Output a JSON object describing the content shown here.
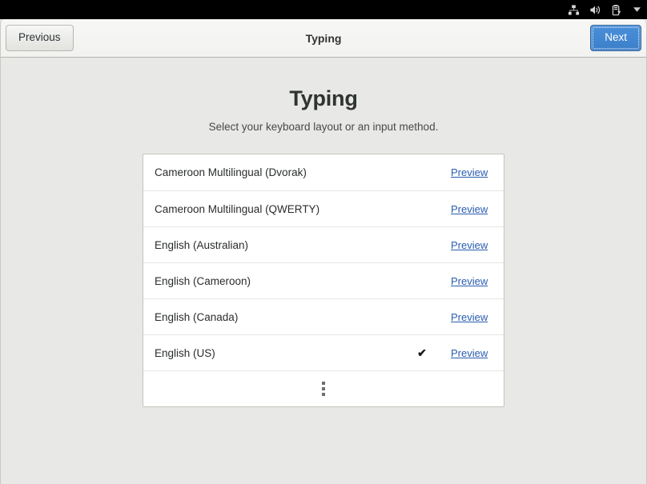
{
  "topbar": {
    "icons": [
      {
        "name": "network-wired-icon",
        "label": "Wired Network"
      },
      {
        "name": "volume-high-icon",
        "label": "Volume"
      },
      {
        "name": "battery-charging-icon",
        "label": "Battery Charging"
      },
      {
        "name": "chevron-down-icon",
        "label": "System Menu"
      }
    ]
  },
  "header": {
    "title": "Typing",
    "previous_label": "Previous",
    "next_label": "Next"
  },
  "page": {
    "title": "Typing",
    "subtitle": "Select your keyboard layout or an input method."
  },
  "layout_list": {
    "preview_label": "Preview",
    "check_glyph": "✔",
    "rows": [
      {
        "label": "Cameroon Multilingual (Dvorak)",
        "selected": false
      },
      {
        "label": "Cameroon Multilingual (QWERTY)",
        "selected": false
      },
      {
        "label": "English (Australian)",
        "selected": false
      },
      {
        "label": "English (Cameroon)",
        "selected": false
      },
      {
        "label": "English (Canada)",
        "selected": false
      },
      {
        "label": "English (US)",
        "selected": true
      }
    ],
    "more_button": {
      "name": "show-more-button",
      "glyph": "⋮"
    }
  },
  "colors": {
    "accent": "#4a90d9",
    "link": "#2a5db0",
    "body_bg": "#e8e8e6",
    "header_bg": "#f2f2f0",
    "panel_bg": "#ffffff",
    "topbar_bg": "#000000"
  }
}
